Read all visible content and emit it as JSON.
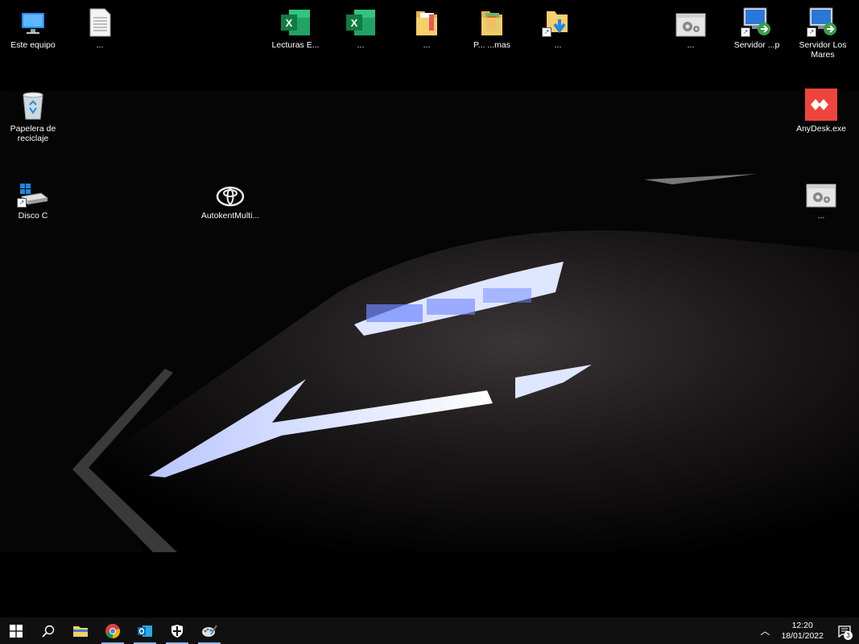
{
  "desktop": {
    "icons": [
      {
        "name": "este-equipo-icon",
        "label": "Este equipo"
      },
      {
        "name": "document-file-icon",
        "label": "..."
      },
      {
        "name": "excel-file-1-icon",
        "label": "Lecturas E..."
      },
      {
        "name": "excel-file-2-icon",
        "label": "..."
      },
      {
        "name": "folder-1-icon",
        "label": "..."
      },
      {
        "name": "folder-2-icon",
        "label": "P... ...mas"
      },
      {
        "name": "download-folder-icon",
        "label": "..."
      },
      {
        "name": "app-settings-1-icon",
        "label": "..."
      },
      {
        "name": "remote-desktop-1-icon",
        "label": "Servidor ...p"
      },
      {
        "name": "remote-desktop-2-icon",
        "label": "Servidor Los Mares"
      },
      {
        "name": "recycle-bin-icon",
        "label": "Papelera de reciclaje"
      },
      {
        "name": "anydesk-icon",
        "label": "AnyDesk.exe"
      },
      {
        "name": "disco-c-icon",
        "label": "Disco C"
      },
      {
        "name": "toyota-app-icon",
        "label": "AutokentMulti..."
      },
      {
        "name": "app-settings-2-icon",
        "label": "..."
      }
    ]
  },
  "taskbar": {
    "time": "12:20",
    "date": "18/01/2022",
    "notification_count": "3",
    "apps": [
      "start",
      "search",
      "file-explorer",
      "chrome",
      "outlook",
      "security",
      "paint"
    ]
  },
  "colors": {
    "taskbar_bg": "#101010",
    "accent": "#8ab4e6",
    "excel": "#1d6f42",
    "anydesk": "#e53935"
  }
}
